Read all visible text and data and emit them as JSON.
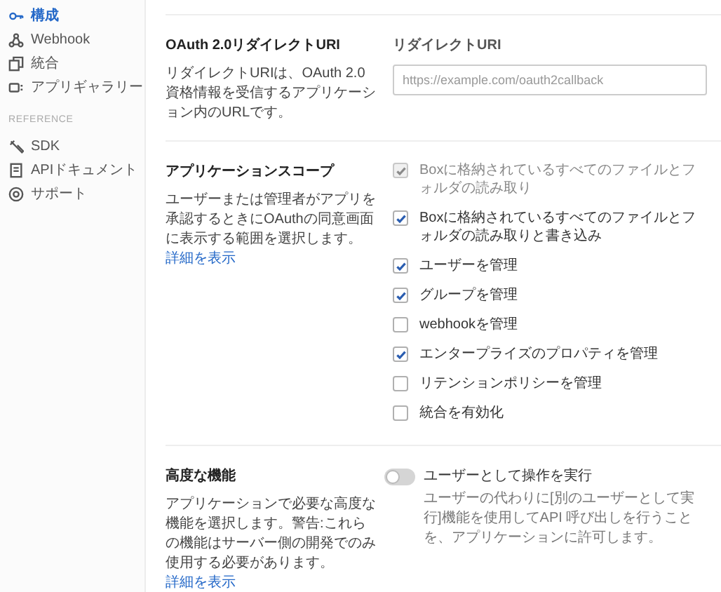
{
  "sidebar": {
    "items": [
      {
        "label": "構成",
        "selected": true
      },
      {
        "label": "Webhook",
        "selected": false
      },
      {
        "label": "統合",
        "selected": false
      },
      {
        "label": "アプリギャラリー",
        "selected": false
      }
    ],
    "reference_heading": "REFERENCE",
    "reference_items": [
      {
        "label": "SDK"
      },
      {
        "label": "APIドキュメント"
      },
      {
        "label": "サポート"
      }
    ]
  },
  "sections": [
    {
      "kind": "redirect",
      "title": "OAuth 2.0リダイレクトURI",
      "description": "リダイレクトURIは、OAuth 2.0資格情報を受信するアプリケーション内のURLです。",
      "field_label": "リダイレクトURI",
      "placeholder": "https://example.com/oauth2callback"
    },
    {
      "kind": "scopes",
      "title": "アプリケーションスコープ",
      "description": "ユーザーまたは管理者がアプリを承認するときにOAuthの同意画面に表示する範囲を選択します。",
      "link": "詳細を表示",
      "scopes": [
        {
          "label": "Boxに格納されているすべてのファイルとフォルダの読み取り",
          "checked": true,
          "disabled": true
        },
        {
          "label": "Boxに格納されているすべてのファイルとフォルダの読み取りと書き込み",
          "checked": true,
          "disabled": false
        },
        {
          "label": "ユーザーを管理",
          "checked": true,
          "disabled": false
        },
        {
          "label": "グループを管理",
          "checked": true,
          "disabled": false
        },
        {
          "label": "webhookを管理",
          "checked": false,
          "disabled": false
        },
        {
          "label": "エンタープライズのプロパティを管理",
          "checked": true,
          "disabled": false
        },
        {
          "label": "リテンションポリシーを管理",
          "checked": false,
          "disabled": false
        },
        {
          "label": "統合を有効化",
          "checked": false,
          "disabled": false
        }
      ]
    },
    {
      "kind": "advanced",
      "title": "高度な機能",
      "description": "アプリケーションで必要な高度な機能を選択します。警告:これらの機能はサーバー側の開発でのみ使用する必要があります。",
      "link": "詳細を表示",
      "toggle": {
        "label": "ユーザーとして操作を実行",
        "on": false,
        "description": "ユーザーの代わりに[別のユーザーとして実行]機能を使用してAPI 呼び出しを行うことを、アプリケーションに許可します。"
      }
    }
  ]
}
